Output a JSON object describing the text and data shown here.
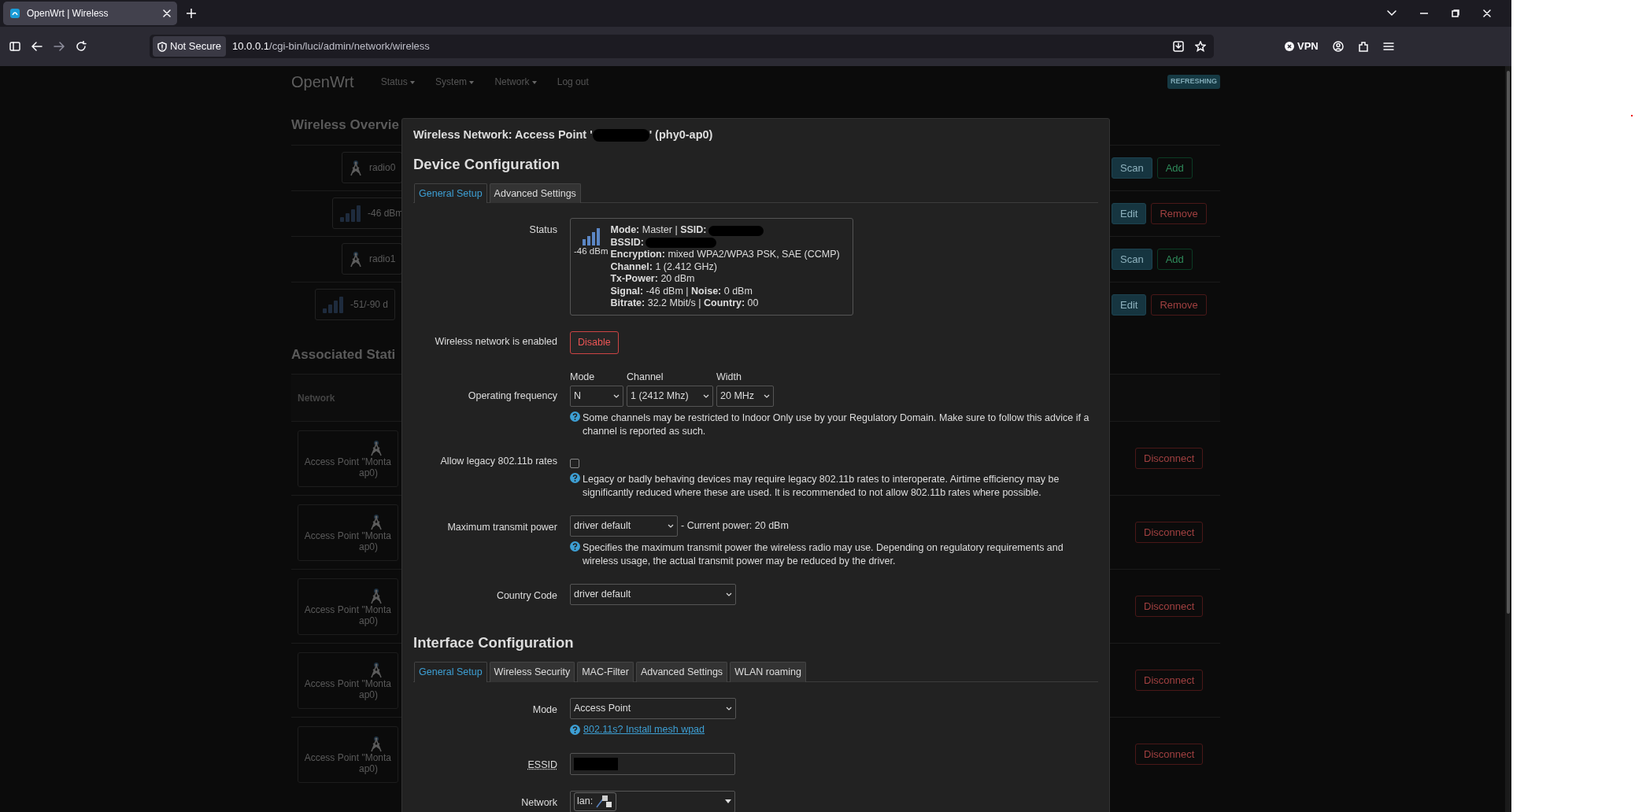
{
  "browser": {
    "tab_title": "OpenWrt | Wireless",
    "security": "Not Secure",
    "url_host": "10.0.0.1",
    "url_path": "/cgi-bin/luci/admin/network/wireless",
    "vpn": "VPN"
  },
  "header": {
    "brand": "OpenWrt",
    "menu": [
      {
        "label": "Status",
        "dropdown": true
      },
      {
        "label": "System",
        "dropdown": true
      },
      {
        "label": "Network",
        "dropdown": true
      },
      {
        "label": "Log out",
        "dropdown": false
      }
    ],
    "badge": "REFRESHING"
  },
  "overview": {
    "title": "Wireless Overvie",
    "rows": [
      {
        "kind": "radio",
        "text": "radio0",
        "buttons": [
          {
            "label": "Scan",
            "kind": "info"
          },
          {
            "label": "Add",
            "kind": "add"
          }
        ]
      },
      {
        "kind": "network",
        "text": "-46 dBm",
        "buttons": [
          {
            "label": "Edit",
            "kind": "info"
          },
          {
            "label": "Remove",
            "kind": "remove"
          }
        ]
      },
      {
        "kind": "radio",
        "text": "radio1",
        "buttons": [
          {
            "label": "Scan",
            "kind": "info"
          },
          {
            "label": "Add",
            "kind": "add"
          }
        ]
      },
      {
        "kind": "network",
        "text": "-51/-90 d",
        "buttons": [
          {
            "label": "Edit",
            "kind": "info"
          },
          {
            "label": "Remove",
            "kind": "remove"
          }
        ]
      }
    ]
  },
  "stations": {
    "title": "Associated Stati",
    "column": "Network",
    "rows": [
      {
        "name": "Access Point \"Monta",
        "name_end": "ap0)",
        "button": "Disconnect"
      },
      {
        "name": "Access Point \"Monta",
        "name_end": "ap0)",
        "button": "Disconnect"
      },
      {
        "name": "Access Point \"Monta",
        "name_end": "ap0)",
        "button": "Disconnect"
      },
      {
        "name": "Access Point \"Monta",
        "name_end": "ap0)",
        "button": "Disconnect"
      },
      {
        "name": "Access Point \"Monta",
        "name_end": "ap0)",
        "button": "Disconnect"
      }
    ]
  },
  "dialog": {
    "title_start": "Wireless Network: Access Point '",
    "title_end": "' (phy0-ap0)",
    "sections": [
      {
        "heading": "Device Configuration",
        "tabs": [
          {
            "label": "General Setup",
            "selected": true
          },
          {
            "label": "Advanced Settings",
            "selected": false
          }
        ],
        "fields": [
          {
            "kind": "status",
            "label": "Status",
            "signal": "-46 dBm",
            "lines": [
              {
                "text": "**Mode:** Master | **SSID:**",
                "redacted": true
              },
              {
                "text": "**BSSID:**",
                "redacted": true
              },
              {
                "text": "**Encryption:** mixed WPA2/WPA3 PSK, SAE (CCMP)",
                "redacted": false
              },
              {
                "text": "**Channel:** 1 (2.412 GHz)",
                "redacted": false
              },
              {
                "text": "**Tx-Power:** 20 dBm",
                "redacted": false
              },
              {
                "text": "**Signal:** -46 dBm | **Noise:** 0 dBm",
                "redacted": false
              },
              {
                "text": "**Bitrate:** 32.2 Mbit/s | **Country:** 00",
                "redacted": false
              }
            ]
          },
          {
            "kind": "button",
            "label": "Wireless network is enabled",
            "button": "Disable"
          },
          {
            "kind": "frequency",
            "label": "Operating frequency",
            "selects": [
              {
                "caption": "Mode",
                "value": "N"
              },
              {
                "caption": "Channel",
                "value": "1 (2412 Mhz)"
              },
              {
                "caption": "Width",
                "value": "20 MHz"
              }
            ],
            "note": "Some channels may be restricted to Indoor Only use by your Regulatory Domain. Make sure to follow this advice if a channel is reported as such."
          },
          {
            "kind": "checkbox",
            "label": "Allow legacy 802.11b rates",
            "checked": false,
            "note": "Legacy or badly behaving devices may require legacy 802.11b rates to interoperate. Airtime efficiency may be significantly reduced where these are used. It is recommended to not allow 802.11b rates where possible."
          },
          {
            "kind": "select",
            "label": "Maximum transmit power",
            "value": "driver default",
            "suffix": "- Current power: 20 dBm",
            "note": "Specifies the maximum transmit power the wireless radio may use. Depending on regulatory requirements and wireless usage, the actual transmit power may be reduced by the driver."
          },
          {
            "kind": "select",
            "label": "Country Code",
            "value": "driver default"
          }
        ]
      },
      {
        "heading": "Interface Configuration",
        "tabs": [
          {
            "label": "General Setup",
            "selected": true
          },
          {
            "label": "Wireless Security",
            "selected": false
          },
          {
            "label": "MAC-Filter",
            "selected": false
          },
          {
            "label": "Advanced Settings",
            "selected": false
          },
          {
            "label": "WLAN roaming",
            "selected": false
          }
        ],
        "fields": [
          {
            "kind": "select",
            "label": "Mode",
            "value": "Access Point",
            "link": "802.11s? Install mesh wpad"
          },
          {
            "kind": "text",
            "label": "ESSID",
            "tooltip": true,
            "redacted": true
          },
          {
            "kind": "network",
            "label": "Network",
            "value": "lan:"
          }
        ]
      }
    ]
  }
}
